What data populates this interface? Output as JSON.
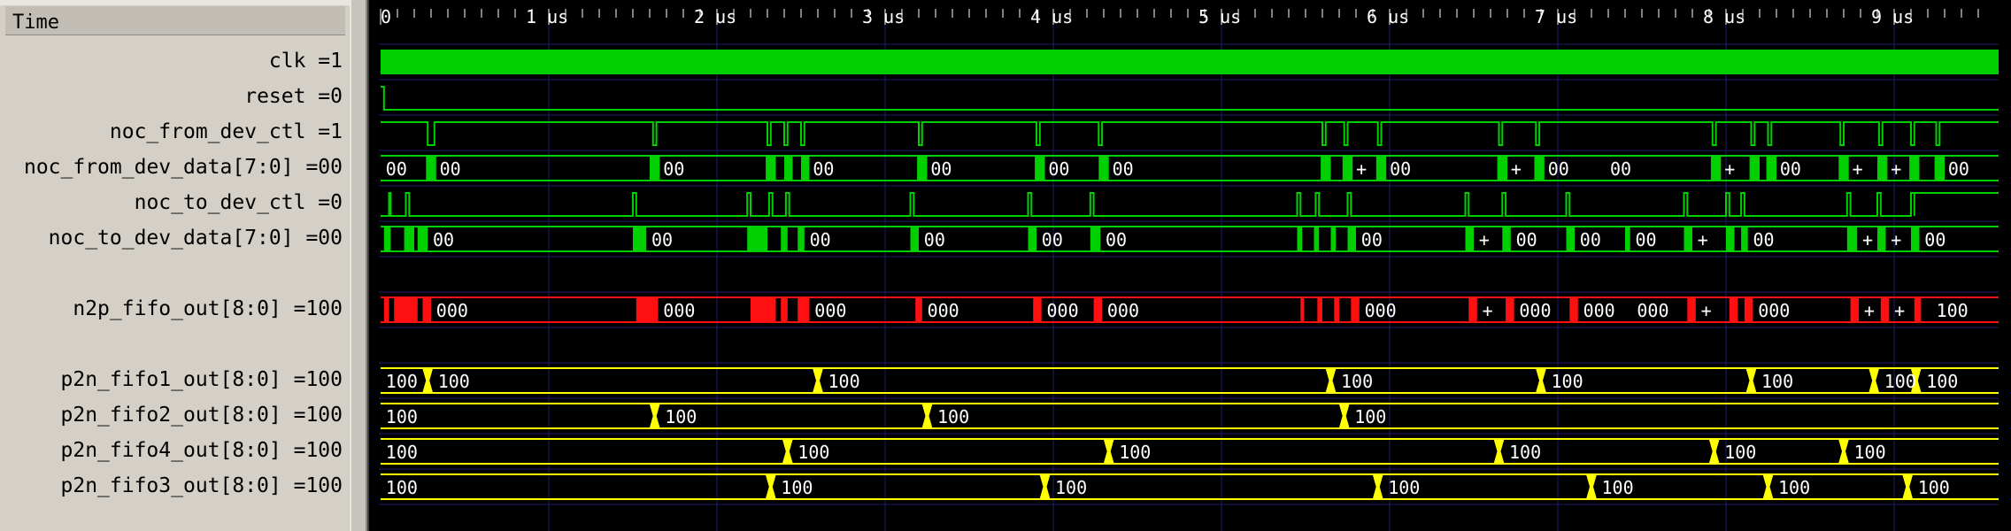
{
  "header_label": "Time",
  "signals": [
    {
      "name": "clk =1"
    },
    {
      "name": "reset =0"
    },
    {
      "name": "noc_from_dev_ctl =1"
    },
    {
      "name": "noc_from_dev_data[7:0] =00"
    },
    {
      "name": "noc_to_dev_ctl =0"
    },
    {
      "name": "noc_to_dev_data[7:0] =00"
    },
    {
      "name": ""
    },
    {
      "name": "n2p_fifo_out[8:0] =100"
    },
    {
      "name": ""
    },
    {
      "name": "p2n_fifo1_out[8:0] =100"
    },
    {
      "name": "p2n_fifo2_out[8:0] =100"
    },
    {
      "name": "p2n_fifo4_out[8:0] =100"
    },
    {
      "name": "p2n_fifo3_out[8:0] =100"
    }
  ],
  "timeline": {
    "ticks": [
      "0",
      "1 us",
      "2 us",
      "3 us",
      "4 us",
      "5 us",
      "6 us",
      "7 us",
      "8 us",
      "9 us"
    ]
  },
  "colors": {
    "green": "#00d000",
    "red": "#ff1010",
    "yellow": "#ffff00",
    "grid": "#1c1c6c",
    "background": "#000000"
  },
  "waves": {
    "reset_rise": 0.02,
    "from_ctl_lows": [
      [
        0.28,
        0.32
      ],
      [
        1.62,
        1.64
      ],
      [
        2.3,
        2.32
      ],
      [
        2.4,
        2.42
      ],
      [
        2.5,
        2.52
      ],
      [
        3.2,
        3.22
      ],
      [
        3.9,
        3.92
      ],
      [
        4.27,
        4.29
      ],
      [
        5.6,
        5.62
      ],
      [
        5.73,
        5.75
      ],
      [
        5.93,
        5.95
      ],
      [
        6.65,
        6.67
      ],
      [
        6.87,
        6.89
      ],
      [
        7.92,
        7.94
      ],
      [
        8.15,
        8.17
      ],
      [
        8.25,
        8.27
      ],
      [
        8.68,
        8.7
      ],
      [
        8.91,
        8.93
      ],
      [
        9.1,
        9.12
      ],
      [
        9.25,
        9.27
      ]
    ],
    "to_ctl_pulses": [
      [
        0.05,
        0.06
      ],
      [
        0.15,
        0.17
      ],
      [
        1.5,
        1.52
      ],
      [
        2.18,
        2.2
      ],
      [
        2.31,
        2.33
      ],
      [
        2.41,
        2.43
      ],
      [
        3.15,
        3.17
      ],
      [
        3.85,
        3.87
      ],
      [
        4.22,
        4.24
      ],
      [
        5.45,
        5.47
      ],
      [
        5.56,
        5.58
      ],
      [
        5.75,
        5.77
      ],
      [
        6.45,
        6.47
      ],
      [
        6.67,
        6.69
      ],
      [
        7.05,
        7.07
      ],
      [
        7.75,
        7.77
      ],
      [
        8.0,
        8.02
      ],
      [
        8.09,
        8.11
      ],
      [
        8.72,
        8.74
      ],
      [
        8.9,
        8.92
      ],
      [
        9.1,
        9.12
      ]
    ],
    "to_ctl_final_rise": 9.12,
    "from_data": {
      "blocks": [
        [
          0.27,
          0.33
        ],
        [
          1.6,
          1.66
        ],
        [
          2.29,
          2.35
        ],
        [
          2.4,
          2.45
        ],
        [
          2.5,
          2.55
        ],
        [
          3.19,
          3.25
        ],
        [
          3.89,
          3.95
        ],
        [
          4.27,
          4.33
        ],
        [
          5.59,
          5.65
        ],
        [
          5.72,
          5.78
        ],
        [
          5.92,
          5.98
        ],
        [
          6.64,
          6.7
        ],
        [
          6.86,
          6.92
        ],
        [
          7.91,
          7.97
        ],
        [
          8.14,
          8.2
        ],
        [
          8.24,
          8.3
        ],
        [
          8.67,
          8.73
        ],
        [
          8.9,
          8.96
        ],
        [
          9.09,
          9.15
        ],
        [
          9.24,
          9.3
        ]
      ],
      "labels": [
        {
          "t": 0.02,
          "text": "00"
        },
        {
          "t": 0.34,
          "text": "00"
        },
        {
          "t": 1.67,
          "text": "00"
        },
        {
          "t": 2.56,
          "text": "00"
        },
        {
          "t": 3.26,
          "text": "00"
        },
        {
          "t": 3.96,
          "text": "00"
        },
        {
          "t": 4.34,
          "text": "00"
        },
        {
          "t": 5.79,
          "text": "+"
        },
        {
          "t": 5.99,
          "text": "00"
        },
        {
          "t": 6.71,
          "text": "+"
        },
        {
          "t": 6.93,
          "text": "00"
        },
        {
          "t": 7.3,
          "text": "00"
        },
        {
          "t": 7.98,
          "text": "+"
        },
        {
          "t": 8.31,
          "text": "00"
        },
        {
          "t": 8.74,
          "text": "+"
        },
        {
          "t": 8.97,
          "text": "+"
        },
        {
          "t": 9.31,
          "text": "00"
        }
      ]
    },
    "to_data": {
      "blocks": [
        [
          0.02,
          0.06
        ],
        [
          0.14,
          0.2
        ],
        [
          0.22,
          0.28
        ],
        [
          1.5,
          1.58
        ],
        [
          2.18,
          2.3
        ],
        [
          2.38,
          2.42
        ],
        [
          2.48,
          2.52
        ],
        [
          3.15,
          3.2
        ],
        [
          3.85,
          3.9
        ],
        [
          4.22,
          4.28
        ],
        [
          5.45,
          5.48
        ],
        [
          5.55,
          5.58
        ],
        [
          5.65,
          5.68
        ],
        [
          5.75,
          5.8
        ],
        [
          6.45,
          6.5
        ],
        [
          6.67,
          6.72
        ],
        [
          7.05,
          7.1
        ],
        [
          7.4,
          7.43
        ],
        [
          7.75,
          7.8
        ],
        [
          8.0,
          8.05
        ],
        [
          8.09,
          8.13
        ],
        [
          8.72,
          8.78
        ],
        [
          8.9,
          8.95
        ],
        [
          9.1,
          9.15
        ]
      ],
      "labels": [
        {
          "t": 0.3,
          "text": "00"
        },
        {
          "t": 1.6,
          "text": "00"
        },
        {
          "t": 2.54,
          "text": "00"
        },
        {
          "t": 3.22,
          "text": "00"
        },
        {
          "t": 3.92,
          "text": "00"
        },
        {
          "t": 4.3,
          "text": "00"
        },
        {
          "t": 5.82,
          "text": "00"
        },
        {
          "t": 6.52,
          "text": "+"
        },
        {
          "t": 6.74,
          "text": "00"
        },
        {
          "t": 7.12,
          "text": "00"
        },
        {
          "t": 7.45,
          "text": "00"
        },
        {
          "t": 7.82,
          "text": "+"
        },
        {
          "t": 8.15,
          "text": "00"
        },
        {
          "t": 8.8,
          "text": "+"
        },
        {
          "t": 8.97,
          "text": "+"
        },
        {
          "t": 9.17,
          "text": "00"
        }
      ]
    },
    "n2p": {
      "blocks": [
        [
          0.02,
          0.05
        ],
        [
          0.08,
          0.22
        ],
        [
          0.25,
          0.3
        ],
        [
          1.52,
          1.65
        ],
        [
          2.2,
          2.35
        ],
        [
          2.38,
          2.42
        ],
        [
          2.48,
          2.55
        ],
        [
          3.18,
          3.22
        ],
        [
          3.88,
          3.93
        ],
        [
          4.24,
          4.29
        ],
        [
          5.47,
          5.49
        ],
        [
          5.57,
          5.6
        ],
        [
          5.67,
          5.7
        ],
        [
          5.77,
          5.82
        ],
        [
          6.47,
          6.52
        ],
        [
          6.69,
          6.74
        ],
        [
          7.07,
          7.12
        ],
        [
          7.77,
          7.82
        ],
        [
          8.02,
          8.07
        ],
        [
          8.11,
          8.16
        ],
        [
          8.74,
          8.79
        ],
        [
          8.92,
          8.97
        ],
        [
          9.12,
          9.16
        ]
      ],
      "labels": [
        {
          "t": 0.32,
          "text": "000"
        },
        {
          "t": 1.67,
          "text": "000"
        },
        {
          "t": 2.57,
          "text": "000"
        },
        {
          "t": 3.24,
          "text": "000"
        },
        {
          "t": 3.95,
          "text": "000"
        },
        {
          "t": 4.31,
          "text": "000"
        },
        {
          "t": 5.84,
          "text": "000"
        },
        {
          "t": 6.54,
          "text": "+"
        },
        {
          "t": 6.76,
          "text": "000"
        },
        {
          "t": 7.14,
          "text": "000"
        },
        {
          "t": 7.46,
          "text": "000"
        },
        {
          "t": 7.84,
          "text": "+"
        },
        {
          "t": 8.18,
          "text": "000"
        },
        {
          "t": 8.81,
          "text": "+"
        },
        {
          "t": 8.99,
          "text": "+"
        },
        {
          "t": 9.24,
          "text": "100"
        }
      ]
    },
    "fifo1": {
      "edges": [
        0.28,
        2.6,
        5.65,
        6.9,
        8.15,
        8.88,
        9.13
      ],
      "labels": [
        {
          "t": 0.02,
          "text": "100"
        },
        {
          "t": 0.33,
          "text": "100"
        },
        {
          "t": 2.65,
          "text": "100"
        },
        {
          "t": 5.7,
          "text": "100"
        },
        {
          "t": 6.95,
          "text": "100"
        },
        {
          "t": 8.2,
          "text": "100"
        },
        {
          "t": 8.93,
          "text": "100"
        },
        {
          "t": 9.18,
          "text": "100"
        }
      ]
    },
    "fifo2": {
      "edges": [
        1.63,
        3.25,
        5.73
      ],
      "labels": [
        {
          "t": 0.02,
          "text": "100"
        },
        {
          "t": 1.68,
          "text": "100"
        },
        {
          "t": 3.3,
          "text": "100"
        },
        {
          "t": 5.78,
          "text": "100"
        }
      ]
    },
    "fifo4": {
      "edges": [
        2.42,
        4.33,
        6.65,
        7.93,
        8.7
      ],
      "labels": [
        {
          "t": 0.02,
          "text": "100"
        },
        {
          "t": 2.47,
          "text": "100"
        },
        {
          "t": 4.38,
          "text": "100"
        },
        {
          "t": 6.7,
          "text": "100"
        },
        {
          "t": 7.98,
          "text": "100"
        },
        {
          "t": 8.75,
          "text": "100"
        }
      ]
    },
    "fifo3": {
      "edges": [
        2.32,
        3.95,
        5.93,
        7.2,
        8.25,
        9.08
      ],
      "labels": [
        {
          "t": 0.02,
          "text": "100"
        },
        {
          "t": 2.37,
          "text": "100"
        },
        {
          "t": 4.0,
          "text": "100"
        },
        {
          "t": 5.98,
          "text": "100"
        },
        {
          "t": 7.25,
          "text": "100"
        },
        {
          "t": 8.3,
          "text": "100"
        },
        {
          "t": 9.13,
          "text": "100"
        }
      ]
    }
  }
}
